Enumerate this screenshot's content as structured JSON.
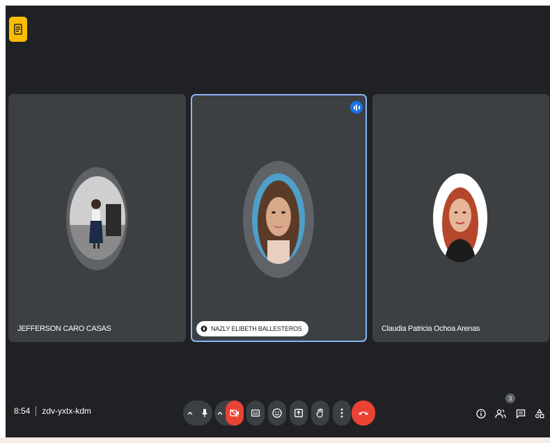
{
  "meeting": {
    "time": "8:54",
    "code": "zdv-yxtx-kdm"
  },
  "participants": [
    {
      "name": "JEFFERSON CARO CASAS"
    },
    {
      "name": "NAZLY ELIBETH BALLESTEROS",
      "speaking": true,
      "pinned": true
    },
    {
      "name": "Claudia Patricia Ochoa Arenas"
    }
  ],
  "people_count": "3",
  "icons": {
    "activity": "activities-icon",
    "mic": "microphone-icon",
    "camera": "camera-off-icon",
    "captions": "captions-icon",
    "emoji": "emoji-icon",
    "present": "present-screen-icon",
    "hand": "raise-hand-icon",
    "more": "more-options-icon",
    "leave": "leave-call-icon",
    "info": "info-icon",
    "people": "people-icon",
    "chat": "chat-icon",
    "tools": "activities-tools-icon"
  },
  "colors": {
    "background": "#202124",
    "tile": "#3c4043",
    "leave": "#ea4335",
    "speaking_border": "#8ab4f8",
    "accent_yellow": "#fbbc04"
  }
}
